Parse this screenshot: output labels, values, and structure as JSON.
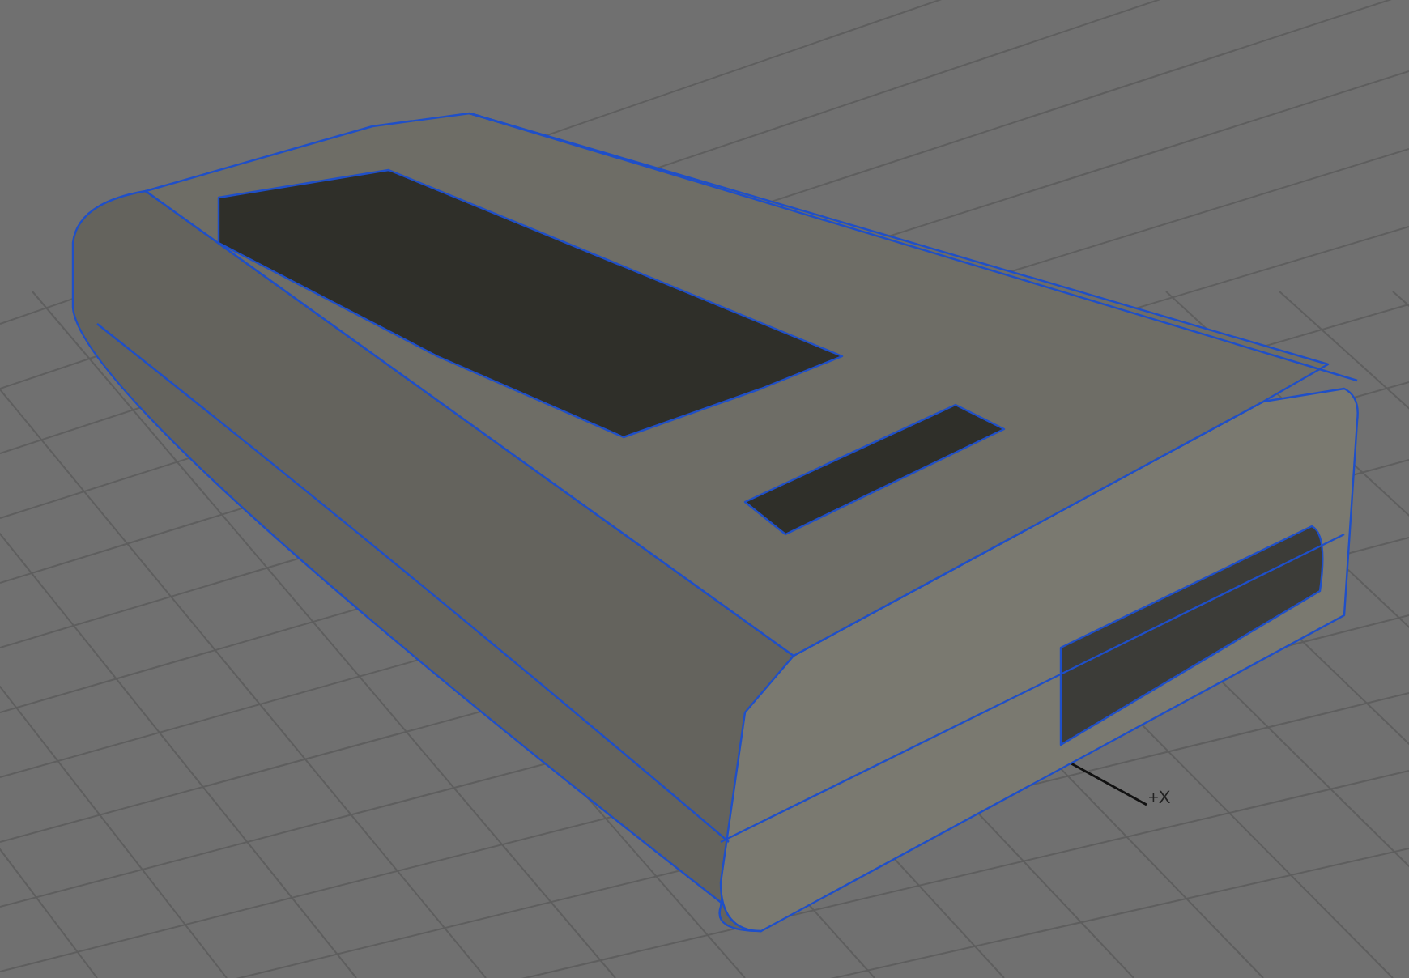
{
  "viewport": {
    "axis_label": "+X"
  }
}
